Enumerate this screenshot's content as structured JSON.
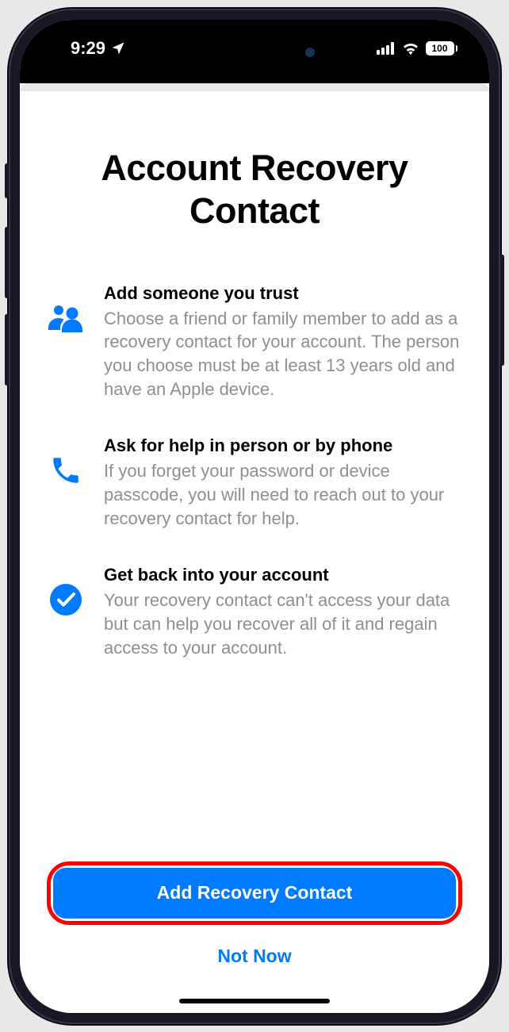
{
  "status": {
    "time": "9:29",
    "battery_pct": "100"
  },
  "page": {
    "title": "Account Recovery Contact",
    "sections": [
      {
        "icon": "people-icon",
        "title": "Add someone you trust",
        "desc": "Choose a friend or family member to add as a recovery contact for your account. The person you choose must be at least 13 years old and have an Apple device."
      },
      {
        "icon": "phone-icon",
        "title": "Ask for help in person or by phone",
        "desc": "If you forget your password or device passcode, you will need to reach out to your recovery contact for help."
      },
      {
        "icon": "checkmark-icon",
        "title": "Get back into your account",
        "desc": "Your recovery contact can't access your data but can help you recover all of it and regain access to your account."
      }
    ],
    "primary_action": "Add Recovery Contact",
    "secondary_action": "Not Now"
  },
  "annotation": {
    "highlighted": "primary_action",
    "color": "#ff0000"
  }
}
